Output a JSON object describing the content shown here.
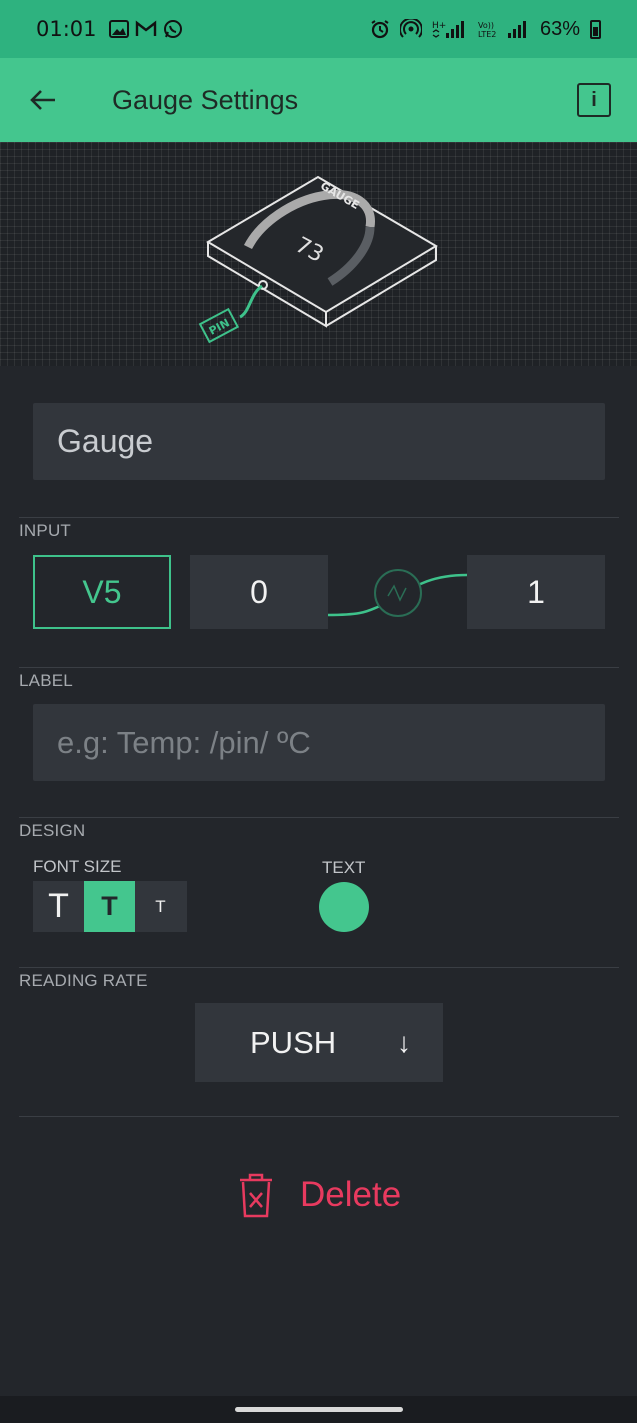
{
  "status_bar": {
    "time": "01:01",
    "left_icons": [
      "gallery-icon",
      "gmail-icon",
      "whatsapp-icon"
    ],
    "right_icons": [
      "alarm-icon",
      "hotspot-icon",
      "signal-icon",
      "volte-icon",
      "signal-icon"
    ],
    "network_label": "Vo)) LTE2",
    "battery": "63%"
  },
  "app_bar": {
    "title": "Gauge Settings",
    "back_icon": "arrow-left-icon",
    "info_icon": "info-icon",
    "info_glyph": "i"
  },
  "preview": {
    "widget_label": "GAUGE",
    "gauge_value": "73",
    "pin_label": "PIN"
  },
  "name_field": {
    "value": "Gauge"
  },
  "input": {
    "section_title": "INPUT",
    "pin": "V5",
    "min": "0",
    "max": "1"
  },
  "label": {
    "section_title": "LABEL",
    "placeholder": "e.g: Temp: /pin/ ºC"
  },
  "design": {
    "section_title": "DESIGN",
    "font_size_label": "FONT SIZE",
    "font_sizes": [
      "T",
      "T",
      "T"
    ],
    "selected_font_size": 1,
    "text_label": "TEXT",
    "text_color": "#44c68e"
  },
  "reading_rate": {
    "section_title": "READING RATE",
    "value": "PUSH",
    "arrow": "↓"
  },
  "delete": {
    "label": "Delete",
    "icon": "trash-icon"
  },
  "colors": {
    "accent": "#44c68e",
    "status_bar": "#2eb27f",
    "background": "#23262b",
    "field": "#32363c",
    "danger": "#e83a5f"
  }
}
